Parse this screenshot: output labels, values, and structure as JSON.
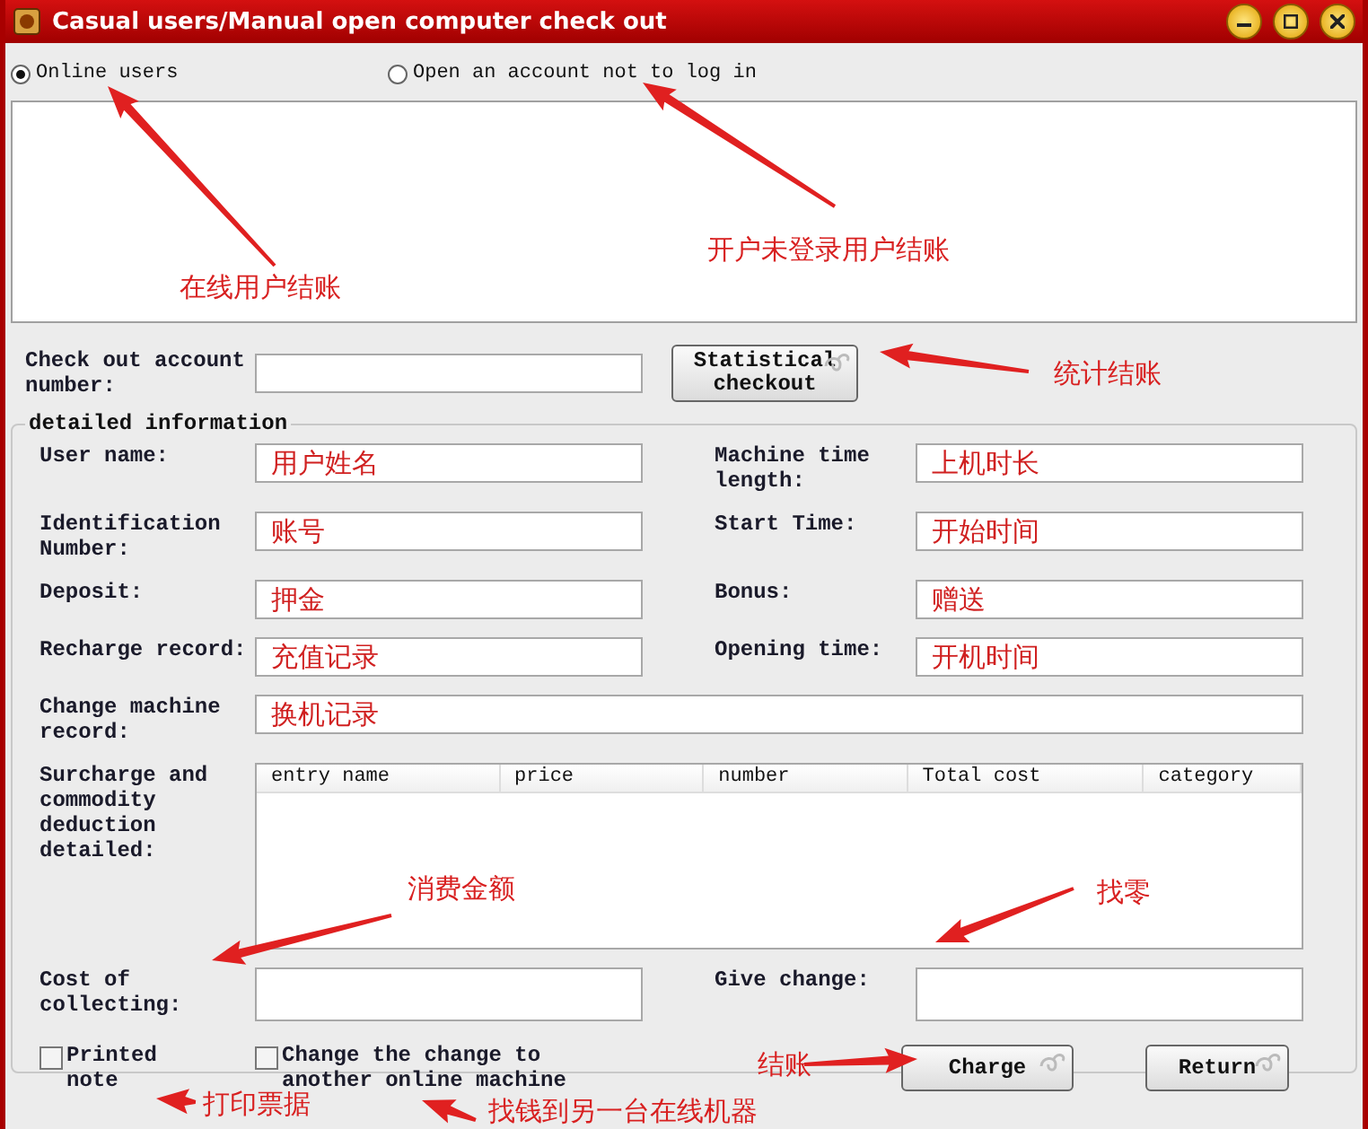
{
  "window": {
    "title": "Casual users/Manual open computer check out"
  },
  "modes": [
    {
      "label": "Online users",
      "selected": true
    },
    {
      "label": "Open an account not to log in",
      "selected": false
    }
  ],
  "checkout": {
    "label": "Check out account number:",
    "button": "Statistical checkout"
  },
  "details": {
    "title": "detailed information",
    "fields": [
      {
        "label": "User name:",
        "value": "用户姓名",
        "kind": "half"
      },
      {
        "label": "Machine time length:",
        "value": "上机时长",
        "kind": "half"
      },
      {
        "label": "Identification Number:",
        "value": "账号",
        "kind": "half"
      },
      {
        "label": "Start Time:",
        "value": "开始时间",
        "kind": "half"
      },
      {
        "label": "Deposit:",
        "value": "押金",
        "kind": "half"
      },
      {
        "label": "Bonus:",
        "value": "赠送",
        "kind": "half"
      },
      {
        "label": "Recharge record:",
        "value": "充值记录",
        "kind": "half"
      },
      {
        "label": "Opening time:",
        "value": "开机时间",
        "kind": "half"
      },
      {
        "label": "Change machine record:",
        "value": "换机记录",
        "kind": "wide"
      }
    ]
  },
  "table": {
    "label": "Surcharge and commodity deduction detailed:",
    "columns": [
      "entry name",
      "price",
      "number",
      "Total cost",
      "category"
    ]
  },
  "cost": {
    "label": "Cost of collecting:"
  },
  "change": {
    "label": "Give change:"
  },
  "options": [
    {
      "label": "Printed note",
      "checked": false
    },
    {
      "label": "Change the change to another online machine",
      "checked": false
    }
  ],
  "buttons": [
    "Charge",
    "Return"
  ],
  "annotations": [
    "在线用户结账",
    "开户未登录用户结账",
    "统计结账",
    "消费金额",
    "找零",
    "结账",
    "打印票据",
    "找钱到另一台在线机器"
  ]
}
